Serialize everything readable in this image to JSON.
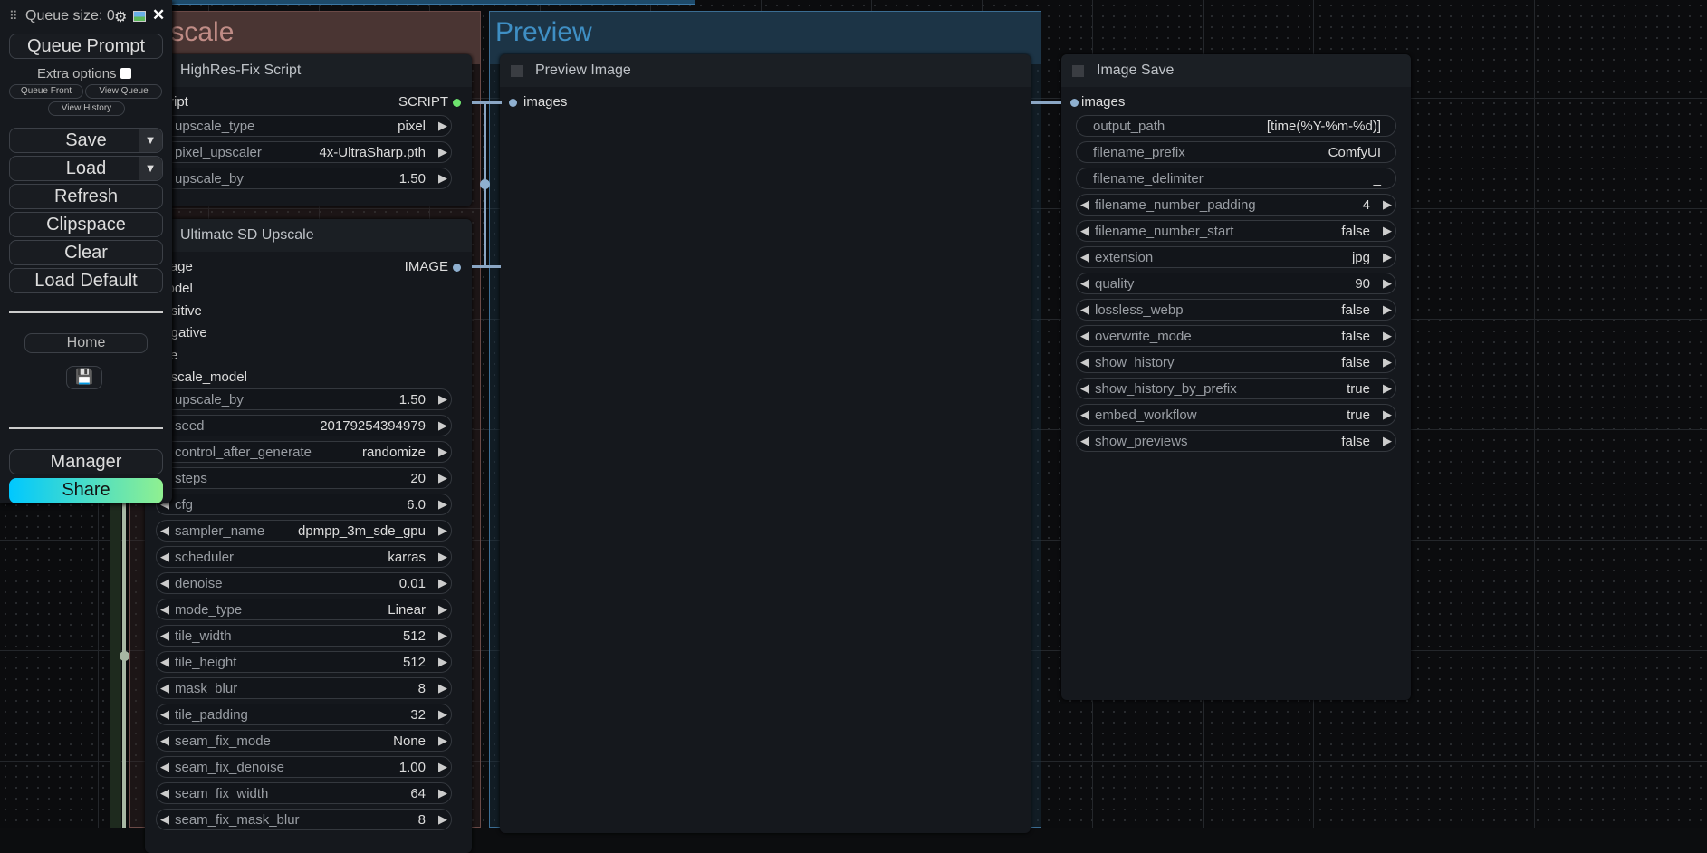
{
  "sidebar": {
    "queue_size": "Queue size: 0",
    "queue_prompt": "Queue Prompt",
    "extra_options": "Extra options",
    "extra_options_checked": false,
    "queue_front": "Queue Front",
    "view_queue": "View Queue",
    "view_history": "View History",
    "save": "Save",
    "load": "Load",
    "refresh": "Refresh",
    "clipspace": "Clipspace",
    "clear": "Clear",
    "load_default": "Load Default",
    "home": "Home",
    "manager": "Manager",
    "share": "Share",
    "share_gradient": [
      "#00c8ff",
      "#90f090"
    ],
    "icons": [
      "drag-handle-icon",
      "gear-icon",
      "image-icon",
      "close-icon",
      "floppy-disk-icon"
    ]
  },
  "groups": {
    "upscale": {
      "title": "Upscale",
      "color": "#4a3533"
    },
    "preview": {
      "title": "Preview",
      "color": "#1c3446"
    }
  },
  "highres": {
    "title": "HighRes-Fix Script",
    "input": "script",
    "output": "SCRIPT",
    "widgets": [
      {
        "label": "upscale_type",
        "value": "pixel"
      },
      {
        "label": "pixel_upscaler",
        "value": "4x-UltraSharp.pth"
      },
      {
        "label": "upscale_by",
        "value": "1.50"
      }
    ]
  },
  "ultimate": {
    "title": "Ultimate SD Upscale",
    "output": "IMAGE",
    "inputs": [
      "image",
      "model",
      "positive",
      "negative",
      "vae",
      "upscale_model"
    ],
    "widgets": [
      {
        "label": "upscale_by",
        "value": "1.50"
      },
      {
        "label": "seed",
        "value": "20179254394979"
      },
      {
        "label": "control_after_generate",
        "value": "randomize"
      },
      {
        "label": "steps",
        "value": "20"
      },
      {
        "label": "cfg",
        "value": "6.0"
      },
      {
        "label": "sampler_name",
        "value": "dpmpp_3m_sde_gpu"
      },
      {
        "label": "scheduler",
        "value": "karras"
      },
      {
        "label": "denoise",
        "value": "0.01"
      },
      {
        "label": "mode_type",
        "value": "Linear"
      },
      {
        "label": "tile_width",
        "value": "512"
      },
      {
        "label": "tile_height",
        "value": "512"
      },
      {
        "label": "mask_blur",
        "value": "8"
      },
      {
        "label": "tile_padding",
        "value": "32"
      },
      {
        "label": "seam_fix_mode",
        "value": "None"
      },
      {
        "label": "seam_fix_denoise",
        "value": "1.00"
      },
      {
        "label": "seam_fix_width",
        "value": "64"
      },
      {
        "label": "seam_fix_mask_blur",
        "value": "8"
      }
    ]
  },
  "preview": {
    "title": "Preview Image",
    "input": "images"
  },
  "imagesave": {
    "title": "Image Save",
    "input": "images",
    "widgets": [
      {
        "label": "output_path",
        "value": "[time(%Y-%m-%d)]",
        "arrows": false
      },
      {
        "label": "filename_prefix",
        "value": "ComfyUI",
        "arrows": false
      },
      {
        "label": "filename_delimiter",
        "value": "_",
        "arrows": false
      },
      {
        "label": "filename_number_padding",
        "value": "4",
        "arrows": true
      },
      {
        "label": "filename_number_start",
        "value": "false",
        "arrows": true
      },
      {
        "label": "extension",
        "value": "jpg",
        "arrows": true
      },
      {
        "label": "quality",
        "value": "90",
        "arrows": true
      },
      {
        "label": "lossless_webp",
        "value": "false",
        "arrows": true
      },
      {
        "label": "overwrite_mode",
        "value": "false",
        "arrows": true
      },
      {
        "label": "show_history",
        "value": "false",
        "arrows": true
      },
      {
        "label": "show_history_by_prefix",
        "value": "true",
        "arrows": true
      },
      {
        "label": "embed_workflow",
        "value": "true",
        "arrows": true
      },
      {
        "label": "show_previews",
        "value": "false",
        "arrows": true
      }
    ]
  }
}
